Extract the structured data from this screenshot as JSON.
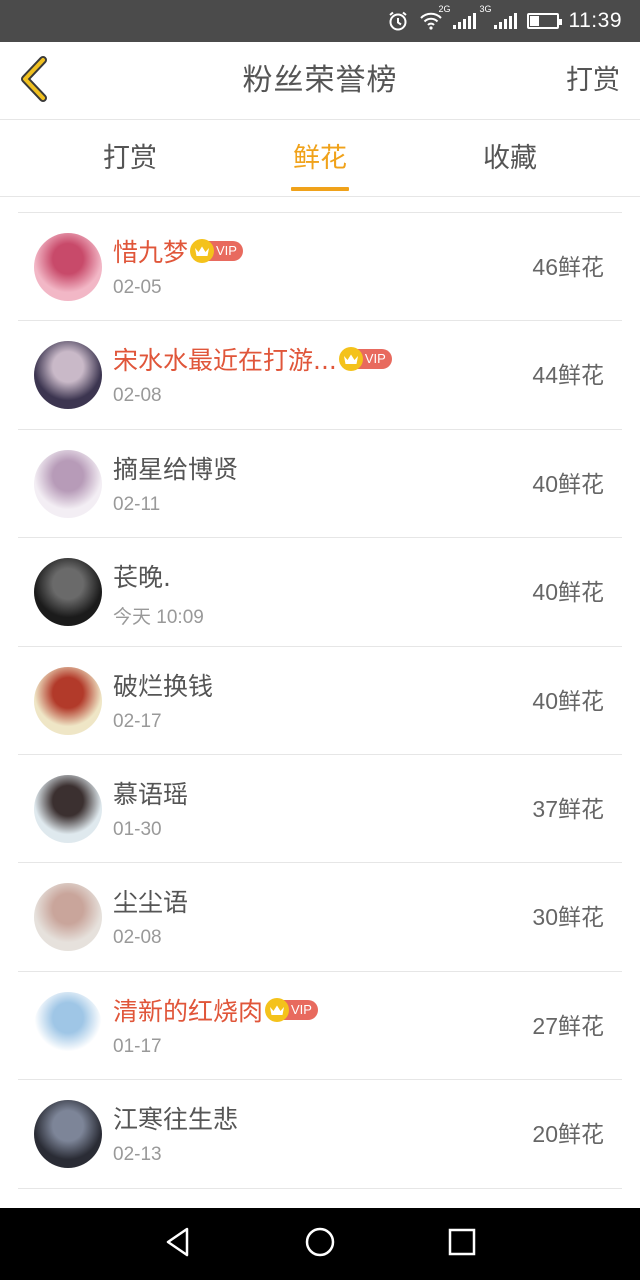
{
  "status_bar": {
    "time": "11:39",
    "network1": "2G",
    "network2": "3G",
    "battery_level": 0.35,
    "icons": [
      "alarm-icon",
      "wifi-icon",
      "signal-icon",
      "signal-icon",
      "battery-icon"
    ]
  },
  "header": {
    "title": "粉丝荣誉榜",
    "right_action": "打赏",
    "back_icon": "chevron-left-icon"
  },
  "tabs": [
    {
      "label": "打赏",
      "active": false
    },
    {
      "label": "鲜花",
      "active": true
    },
    {
      "label": "收藏",
      "active": false
    }
  ],
  "colors": {
    "accent": "#f0a21a",
    "vip_name": "#e0563a",
    "vip_badge": "#e86a5e",
    "crown": "#f4c21b"
  },
  "vip_label": "VIP",
  "fans": [
    {
      "name": "惜九梦",
      "vip": true,
      "date": "02-05",
      "count": "46鲜花",
      "avatar_colors": [
        "#f2b7c6",
        "#c84a6a"
      ]
    },
    {
      "name": "宋水水最近在打游...",
      "vip": true,
      "date": "02-08",
      "count": "44鲜花",
      "avatar_colors": [
        "#3c3550",
        "#c9b9c8"
      ]
    },
    {
      "name": "摘星给博贤",
      "vip": false,
      "date": "02-11",
      "count": "40鲜花",
      "avatar_colors": [
        "#f3eef4",
        "#b79bb8"
      ]
    },
    {
      "name": "苌晚.",
      "vip": false,
      "date": "今天 10:09",
      "count": "40鲜花",
      "avatar_colors": [
        "#1b1b1b",
        "#6a6a6a"
      ]
    },
    {
      "name": "破烂换钱",
      "vip": false,
      "date": "02-17",
      "count": "40鲜花",
      "avatar_colors": [
        "#efe6c6",
        "#b23a2a"
      ]
    },
    {
      "name": "慕语瑶",
      "vip": false,
      "date": "01-30",
      "count": "37鲜花",
      "avatar_colors": [
        "#dfe9ee",
        "#3b3030"
      ]
    },
    {
      "name": "尘尘语",
      "vip": false,
      "date": "02-08",
      "count": "30鲜花",
      "avatar_colors": [
        "#e6e1dc",
        "#c9a59b"
      ]
    },
    {
      "name": "清新的红烧肉",
      "vip": true,
      "date": "01-17",
      "count": "27鲜花",
      "avatar_colors": [
        "#ffffff",
        "#9fc6e6"
      ]
    },
    {
      "name": "江寒往生悲",
      "vip": false,
      "date": "02-13",
      "count": "20鲜花",
      "avatar_colors": [
        "#2a2c35",
        "#7d8598"
      ]
    }
  ],
  "nav": [
    "back-triangle-icon",
    "home-circle-icon",
    "recents-square-icon"
  ]
}
